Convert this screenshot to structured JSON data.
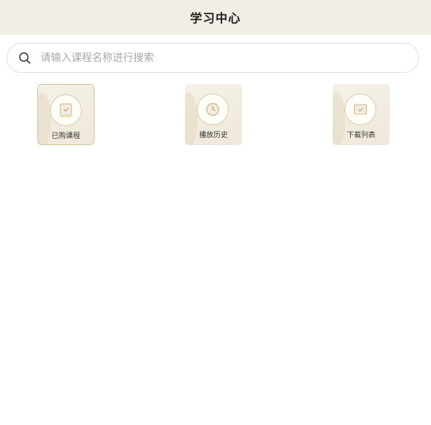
{
  "header": {
    "title": "学习中心"
  },
  "search": {
    "placeholder": "请输入课程名称进行搜索",
    "value": ""
  },
  "tiles": [
    {
      "label": "已购课程",
      "icon": "book-icon",
      "active": true
    },
    {
      "label": "播放历史",
      "icon": "clock-icon",
      "active": false
    },
    {
      "label": "下载列表",
      "icon": "download-list-icon",
      "active": false
    }
  ],
  "colors": {
    "header_bg": "#f1eee6",
    "tile_bg": "#f2ede2",
    "accent": "#d8c6a2"
  }
}
